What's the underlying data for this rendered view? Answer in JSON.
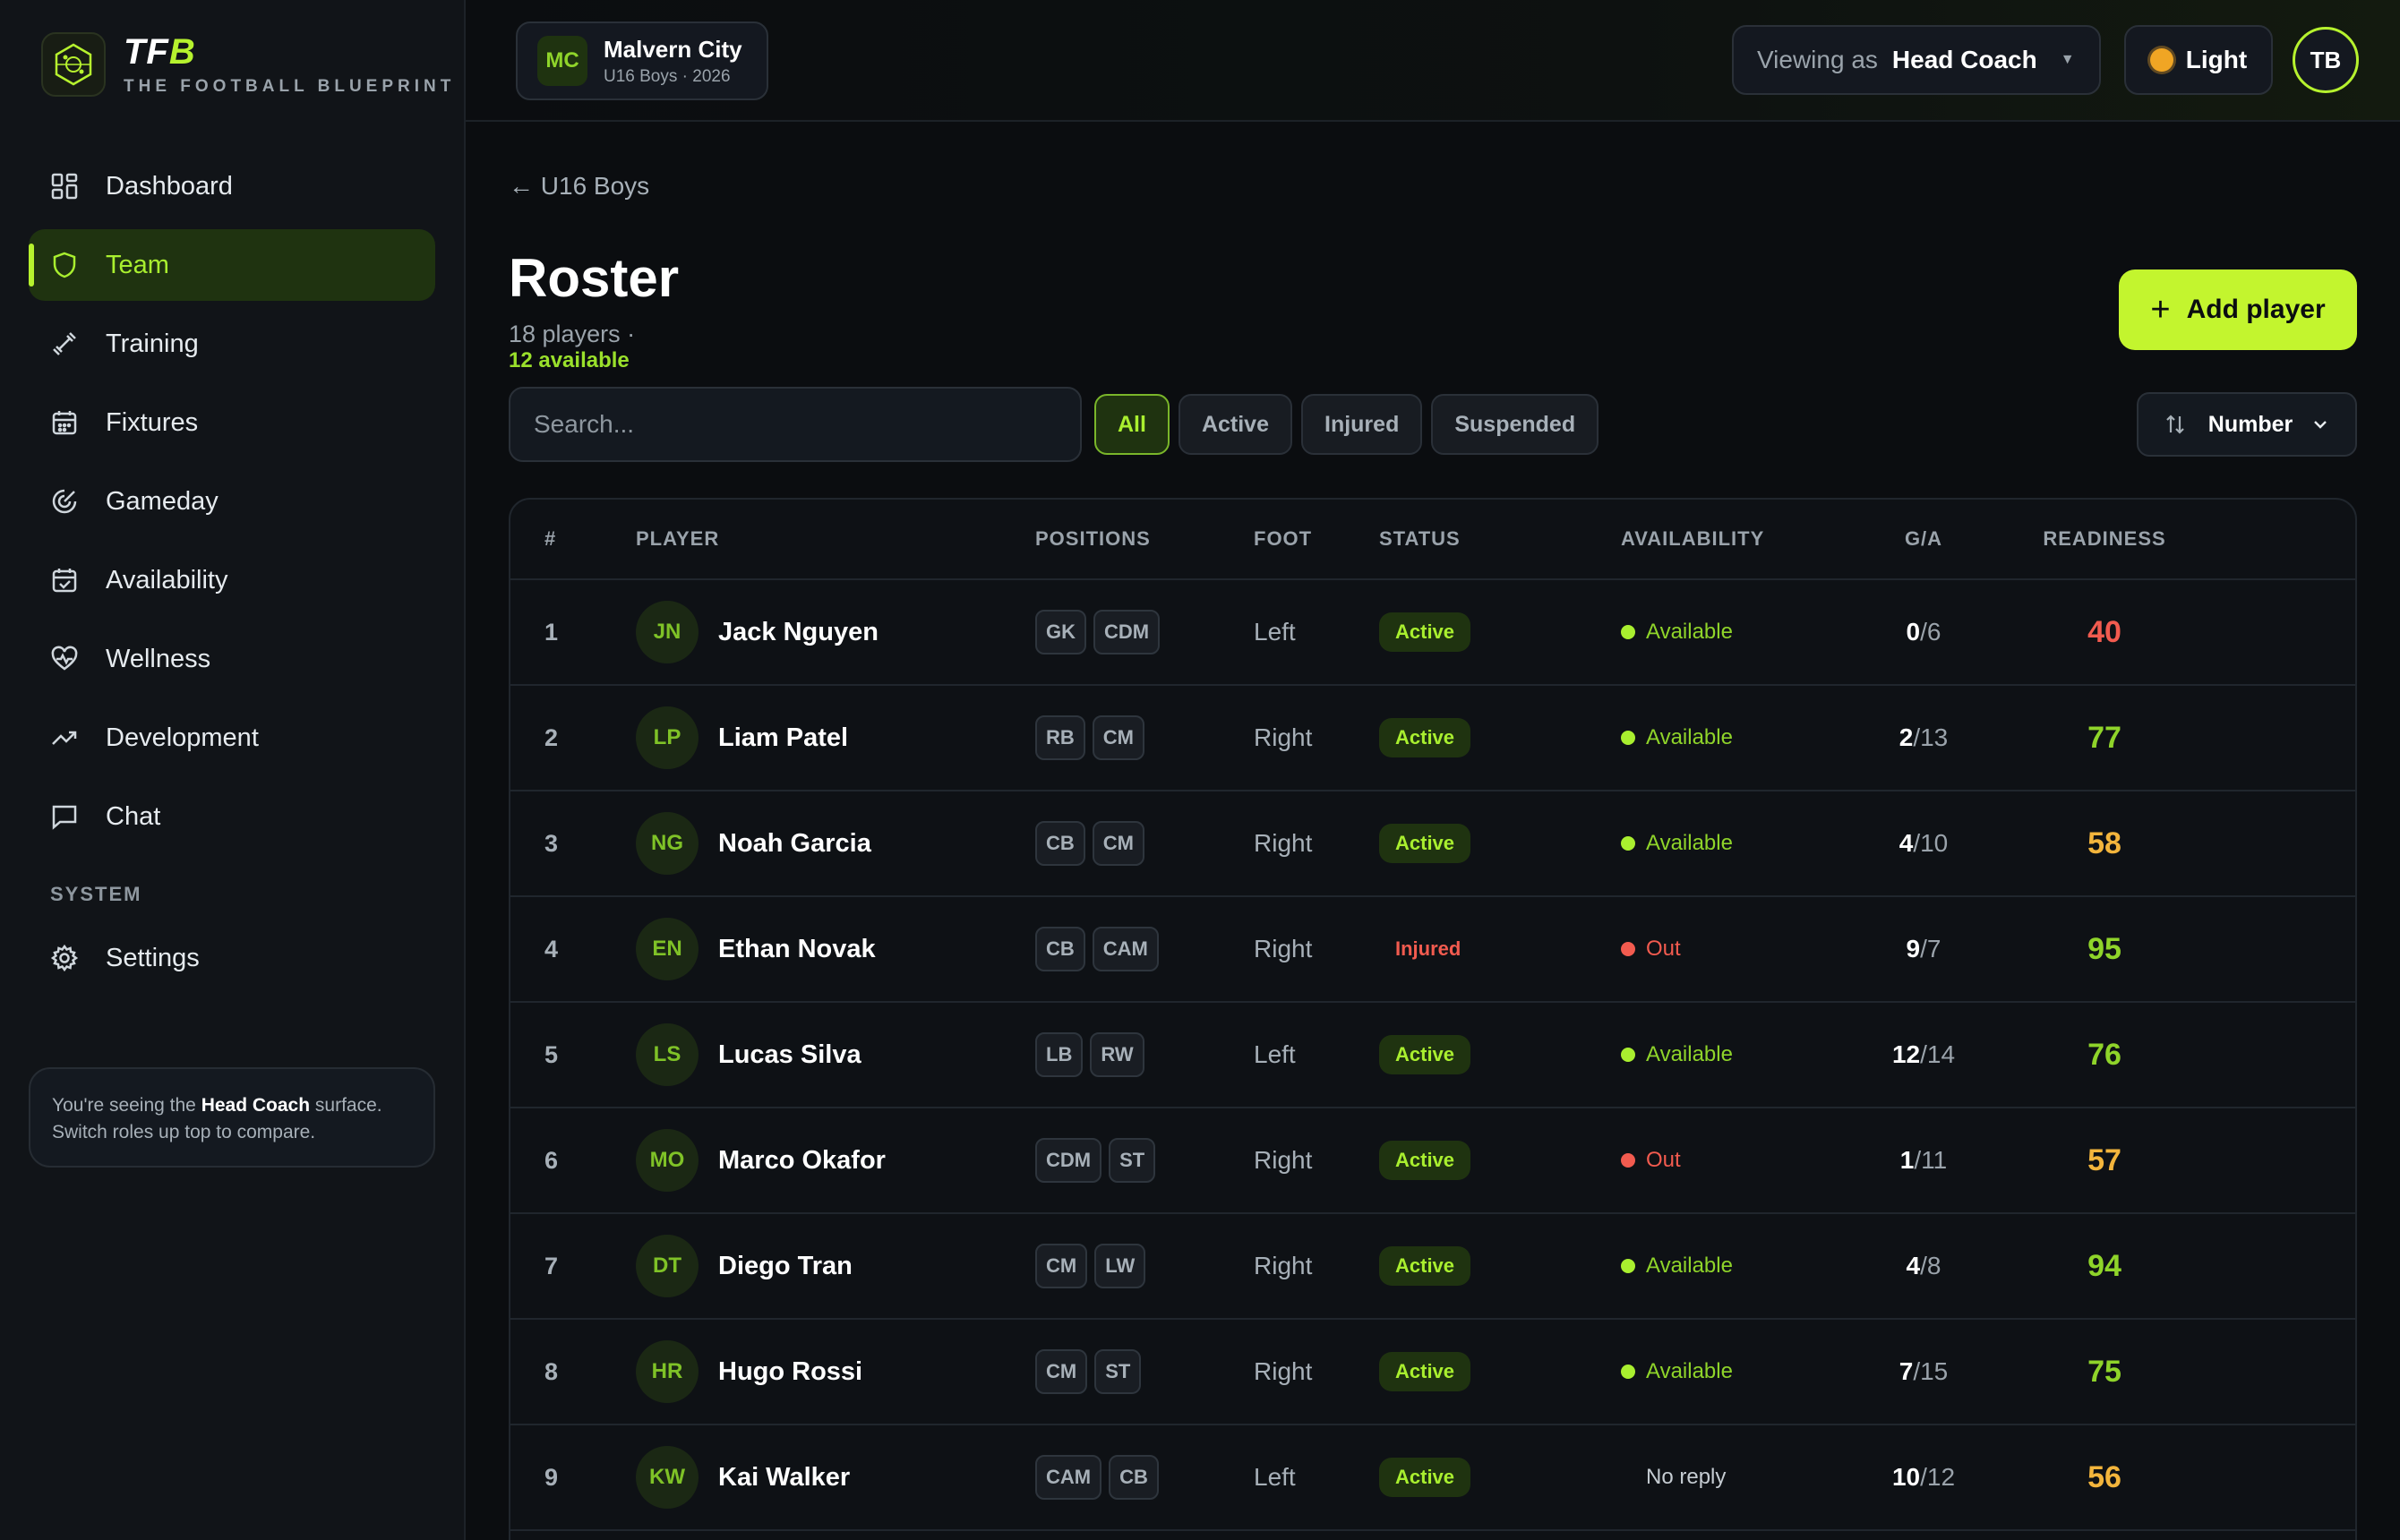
{
  "brand": {
    "name_prefix": "TF",
    "name_suffix": "B",
    "tagline": "THE FOOTBALL BLUEPRINT"
  },
  "sidebar": {
    "items": [
      {
        "label": "Dashboard",
        "icon": "grid-icon",
        "active": false
      },
      {
        "label": "Team",
        "icon": "shield-icon",
        "active": true
      },
      {
        "label": "Training",
        "icon": "dumbbell-icon",
        "active": false
      },
      {
        "label": "Fixtures",
        "icon": "calendar-icon",
        "active": false
      },
      {
        "label": "Gameday",
        "icon": "target-icon",
        "active": false
      },
      {
        "label": "Availability",
        "icon": "calendar-check-icon",
        "active": false
      },
      {
        "label": "Wellness",
        "icon": "heart-pulse-icon",
        "active": false
      },
      {
        "label": "Development",
        "icon": "trending-up-icon",
        "active": false
      },
      {
        "label": "Chat",
        "icon": "chat-icon",
        "active": false
      }
    ],
    "section_label": "SYSTEM",
    "settings_label": "Settings",
    "role_note": {
      "prefix": "You're seeing the ",
      "role": "Head Coach",
      "suffix": " surface. Switch roles up top to compare."
    }
  },
  "topbar": {
    "team_badge": "MC",
    "team_name": "Malvern City",
    "team_sub": "U16 Boys · 2026",
    "viewing_label": "Viewing as",
    "viewing_role": "Head Coach",
    "theme_label": "Light",
    "user_initials": "TB"
  },
  "page": {
    "back_label": "← U16 Boys",
    "title": "Roster",
    "players_count": "18 players",
    "separator": " · ",
    "available_count": "12 available",
    "add_label": "Add player",
    "search_placeholder": "Search...",
    "filters": [
      "All",
      "Active",
      "Injured",
      "Suspended"
    ],
    "active_filter": "All",
    "sort_label": "Number"
  },
  "table": {
    "columns": [
      "#",
      "PLAYER",
      "POSITIONS",
      "FOOT",
      "STATUS",
      "AVAILABILITY",
      "G/A",
      "READINESS"
    ],
    "rows": [
      {
        "num": "1",
        "initials": "JN",
        "name": "Jack Nguyen",
        "positions": [
          "GK",
          "CDM"
        ],
        "foot": "Left",
        "status": "Active",
        "availability": "Available",
        "goals": "0",
        "assists": "/6",
        "readiness": "40"
      },
      {
        "num": "2",
        "initials": "LP",
        "name": "Liam Patel",
        "positions": [
          "RB",
          "CM"
        ],
        "foot": "Right",
        "status": "Active",
        "availability": "Available",
        "goals": "2",
        "assists": "/13",
        "readiness": "77"
      },
      {
        "num": "3",
        "initials": "NG",
        "name": "Noah Garcia",
        "positions": [
          "CB",
          "CM"
        ],
        "foot": "Right",
        "status": "Active",
        "availability": "Available",
        "goals": "4",
        "assists": "/10",
        "readiness": "58"
      },
      {
        "num": "4",
        "initials": "EN",
        "name": "Ethan Novak",
        "positions": [
          "CB",
          "CAM"
        ],
        "foot": "Right",
        "status": "Injured",
        "availability": "Out",
        "goals": "9",
        "assists": "/7",
        "readiness": "95"
      },
      {
        "num": "5",
        "initials": "LS",
        "name": "Lucas Silva",
        "positions": [
          "LB",
          "RW"
        ],
        "foot": "Left",
        "status": "Active",
        "availability": "Available",
        "goals": "12",
        "assists": "/14",
        "readiness": "76"
      },
      {
        "num": "6",
        "initials": "MO",
        "name": "Marco Okafor",
        "positions": [
          "CDM",
          "ST"
        ],
        "foot": "Right",
        "status": "Active",
        "availability": "Out",
        "goals": "1",
        "assists": "/11",
        "readiness": "57"
      },
      {
        "num": "7",
        "initials": "DT",
        "name": "Diego Tran",
        "positions": [
          "CM",
          "LW"
        ],
        "foot": "Right",
        "status": "Active",
        "availability": "Available",
        "goals": "4",
        "assists": "/8",
        "readiness": "94"
      },
      {
        "num": "8",
        "initials": "HR",
        "name": "Hugo Rossi",
        "positions": [
          "CM",
          "ST"
        ],
        "foot": "Right",
        "status": "Active",
        "availability": "Available",
        "goals": "7",
        "assists": "/15",
        "readiness": "75"
      },
      {
        "num": "9",
        "initials": "KW",
        "name": "Kai Walker",
        "positions": [
          "CAM",
          "CB"
        ],
        "foot": "Left",
        "status": "Active",
        "availability": "No reply",
        "goals": "10",
        "assists": "/12",
        "readiness": "56"
      }
    ]
  },
  "colors": {
    "accent": "#b6f22e",
    "danger": "#f25b4f",
    "warning": "#f3b53c",
    "success": "#8fd42a",
    "background": "#0b0d10"
  }
}
